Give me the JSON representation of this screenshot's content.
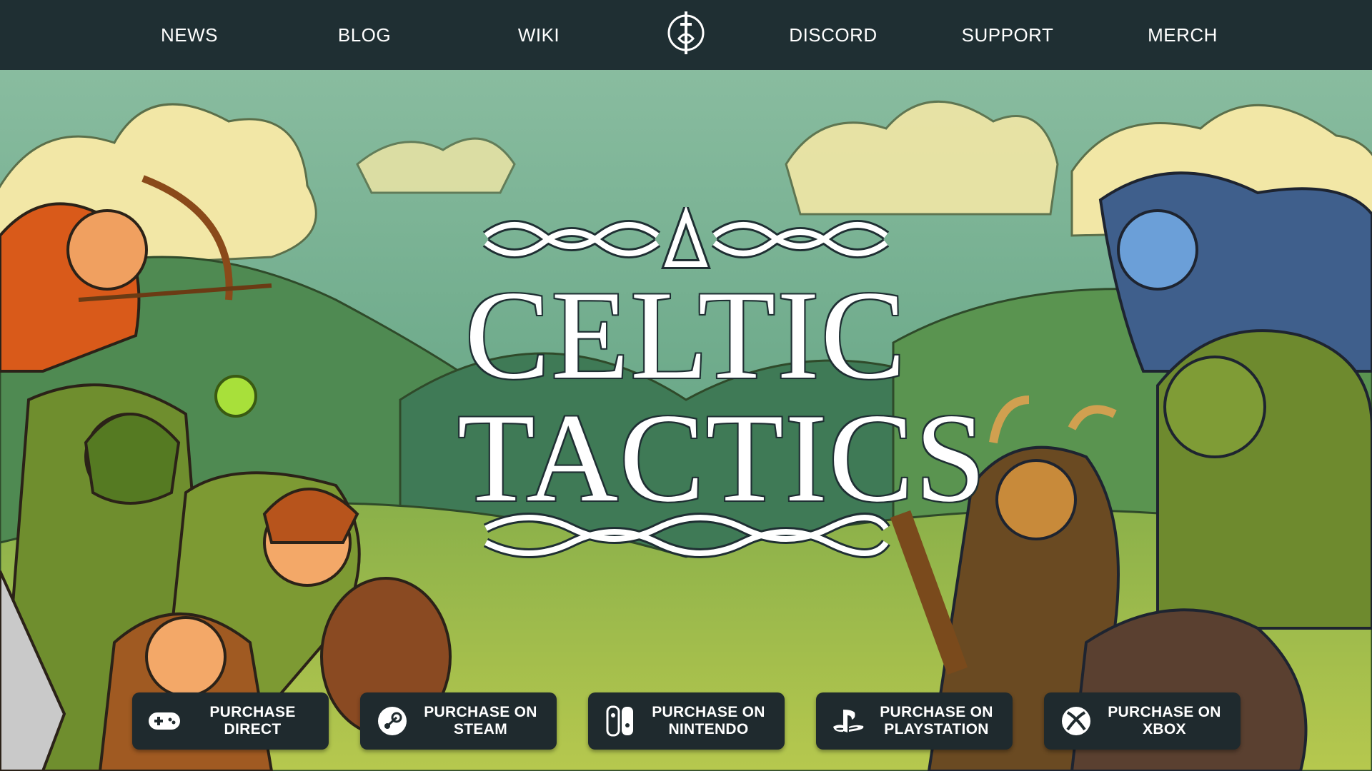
{
  "nav": {
    "items": [
      {
        "label": "NEWS"
      },
      {
        "label": "BLOG"
      },
      {
        "label": "WIKI"
      },
      {
        "label": "DISCORD"
      },
      {
        "label": "SUPPORT"
      },
      {
        "label": "MERCH"
      }
    ],
    "logo_icon": "sword-knot-logo-icon"
  },
  "hero": {
    "title_line1": "CELTIC",
    "title_line2": "TACTICS",
    "ornament_icon": "celtic-knot-icon"
  },
  "purchase": [
    {
      "label": "PURCHASE\nDIRECT",
      "icon": "gamepad-icon"
    },
    {
      "label": "PURCHASE ON\nSTEAM",
      "icon": "steam-icon"
    },
    {
      "label": "PURCHASE ON\nNINTENDO",
      "icon": "nintendo-switch-icon"
    },
    {
      "label": "PURCHASE ON\nPLAYSTATION",
      "icon": "playstation-icon"
    },
    {
      "label": "PURCHASE ON\nXBOX",
      "icon": "xbox-icon"
    }
  ],
  "colors": {
    "nav_bg": "#1f2f33",
    "button_bg": "#1f2a2e",
    "title_text": "#ffffff",
    "sky": "#9cc7a0",
    "hills": "#6e9a45"
  }
}
